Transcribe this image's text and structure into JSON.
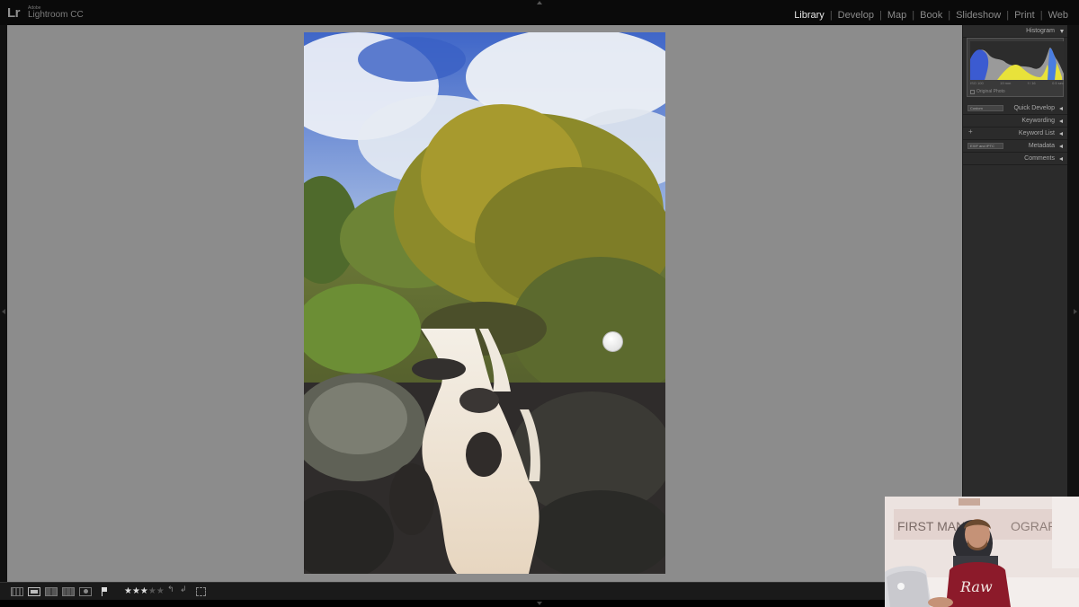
{
  "app": {
    "badge": "Lr",
    "vendor": "Adobe",
    "name": "Lightroom CC"
  },
  "modules": [
    {
      "label": "Library",
      "active": true
    },
    {
      "label": "Develop",
      "active": false
    },
    {
      "label": "Map",
      "active": false
    },
    {
      "label": "Book",
      "active": false
    },
    {
      "label": "Slideshow",
      "active": false
    },
    {
      "label": "Print",
      "active": false
    },
    {
      "label": "Web",
      "active": false
    }
  ],
  "right_panel": {
    "histogram_title": "Histogram",
    "histogram_info": [
      "ISO 100",
      "19 mm",
      "f / 16",
      "0.5 sec"
    ],
    "original_photo_label": "Original Photo",
    "quick_develop": {
      "label": "Quick Develop",
      "preset": "Custom"
    },
    "keywording": {
      "label": "Keywording"
    },
    "keyword_list": {
      "label": "Keyword List"
    },
    "metadata": {
      "label": "Metadata",
      "preset": "EXIF and IPTC"
    },
    "comments": {
      "label": "Comments"
    }
  },
  "toolbar": {
    "rating": 3,
    "stars_filled": "★★★",
    "stars_empty": "★★"
  },
  "webcam": {
    "wall_text": "FIRST MAN",
    "wall_text_right": "OGRAPHY",
    "shirt_text": "Raw"
  },
  "colors": {
    "canvas": "#8c8c8c",
    "panel": "#2b2b2b",
    "active_module": "#e6e6e6",
    "inactive_module": "#8a8a8a"
  }
}
